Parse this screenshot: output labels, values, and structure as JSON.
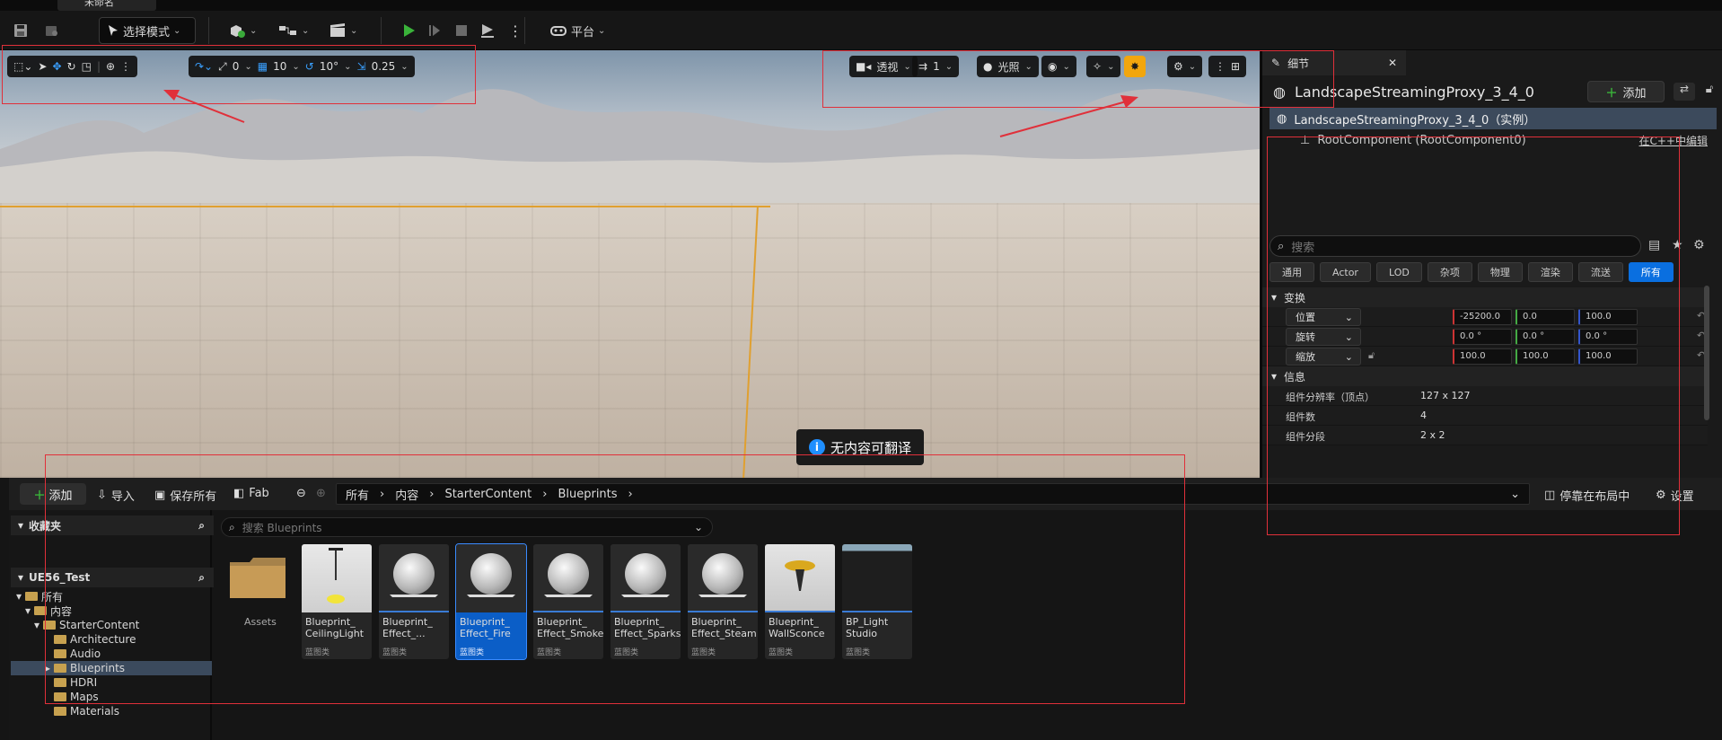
{
  "tab": {
    "title": "未命名"
  },
  "main_toolbar": {
    "mode_label": "选择模式",
    "platform_label": "平台"
  },
  "viewport_toolbar": {
    "translate_snap": "10",
    "rotate_snap": "10°",
    "scale_snap": "0.25",
    "angle_snap": "0",
    "view_mode": "透视",
    "camera_speed": "1",
    "lighting": "光照"
  },
  "toast": {
    "text": "无内容可翻译"
  },
  "details": {
    "tab_title": "细节",
    "actor_name": "LandscapeStreamingProxy_3_4_0",
    "add_label": "添加",
    "instance_row": "LandscapeStreamingProxy_3_4_0（实例）",
    "root_component": "RootComponent (RootComponent0)",
    "cpp_edit": "在C++中编辑",
    "search_placeholder": "搜索",
    "filters": [
      "通用",
      "Actor",
      "LOD",
      "杂项",
      "物理",
      "渲染",
      "流送",
      "所有"
    ],
    "transform_section": "变换",
    "location_label": "位置",
    "rotation_label": "旋转",
    "scale_label": "缩放",
    "location": [
      "-25200.0",
      "0.0",
      "100.0"
    ],
    "rotation": [
      "0.0 °",
      "0.0 °",
      "0.0 °"
    ],
    "scale": [
      "100.0",
      "100.0",
      "100.0"
    ],
    "info_section": "信息",
    "info_rows": [
      {
        "label": "组件分辨率（顶点）",
        "value": "127 x 127"
      },
      {
        "label": "组件数",
        "value": "4"
      },
      {
        "label": "组件分段",
        "value": "2 x 2"
      }
    ]
  },
  "content_browser": {
    "add_label": "添加",
    "import_label": "导入",
    "save_all_label": "保存所有",
    "fab_label": "Fab",
    "breadcrumbs": [
      "所有",
      "内容",
      "StarterContent",
      "Blueprints"
    ],
    "dock_label": "停靠在布局中",
    "settings_label": "设置",
    "favorites_label": "收藏夹",
    "project_label": "UE56_Test",
    "search_placeholder": "搜索 Blueprints",
    "tree": [
      "所有",
      "内容",
      "StarterContent",
      "Architecture",
      "Audio",
      "Blueprints",
      "HDRI",
      "Maps",
      "Materials"
    ],
    "folder_label": "Assets",
    "assets": [
      {
        "name": "Blueprint_ CeilingLight",
        "kind": "蓝图类"
      },
      {
        "name": "Blueprint_ Effect_...",
        "kind": "蓝图类"
      },
      {
        "name": "Blueprint_ Effect_Fire",
        "kind": "蓝图类"
      },
      {
        "name": "Blueprint_ Effect_Smoke",
        "kind": "蓝图类"
      },
      {
        "name": "Blueprint_ Effect_Sparks",
        "kind": "蓝图类"
      },
      {
        "name": "Blueprint_ Effect_Steam",
        "kind": "蓝图类"
      },
      {
        "name": "Blueprint_ WallSconce",
        "kind": "蓝图类"
      },
      {
        "name": "BP_Light Studio",
        "kind": "蓝图类"
      }
    ]
  },
  "colors": {
    "accent": "#0a6fe0",
    "selection_outline": "#e0a030",
    "annotation": "#e0303a"
  }
}
